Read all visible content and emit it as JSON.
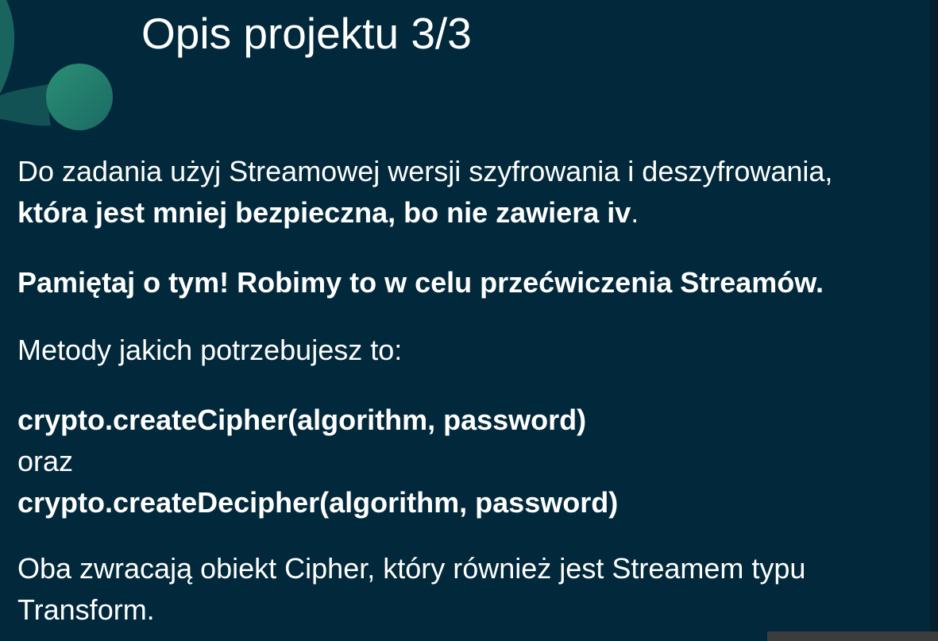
{
  "slide": {
    "title": "Opis projektu 3/3",
    "paragraph1": {
      "line1": "Do zadania użyj Streamowej wersji szyfrowania i deszyfrowania,",
      "line2_bold": "która jest mniej bezpieczna, bo nie zawiera iv",
      "line2_tail": "."
    },
    "paragraph2": "Pamiętaj o tym! Robimy to w celu przećwiczenia Streamów.",
    "paragraph3": "Metody jakich potrzebujesz to:",
    "methods": {
      "cipher": "crypto.createCipher(algorithm, password)",
      "conjunction": "oraz",
      "decipher": "crypto.createDecipher(algorithm, password)"
    },
    "paragraph5": {
      "line1": "Oba zwracają obiekt Cipher, który również jest Streamem typu",
      "line2": "Transform."
    }
  },
  "colors": {
    "background": "#02293b",
    "decoration": "#1f7b6a",
    "text": "#ffffff"
  }
}
